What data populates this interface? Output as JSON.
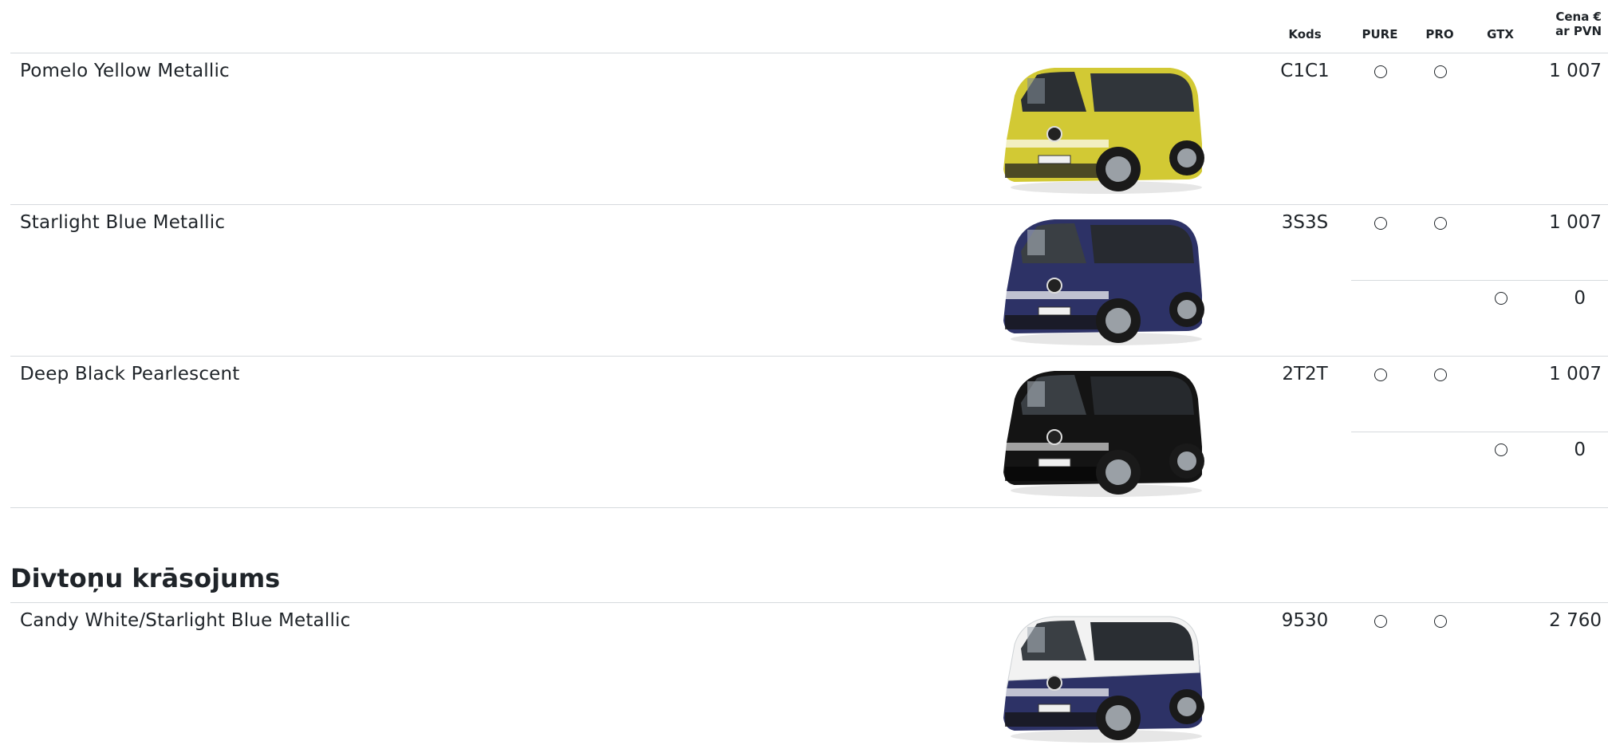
{
  "header": {
    "col_code": "Kods",
    "col_pure": "PURE",
    "col_pro": "PRO",
    "col_gtx": "GTX",
    "col_price_line1": "Cena €",
    "col_price_line2": "ar PVN"
  },
  "colors": {
    "rows": [
      {
        "name": "Pomelo Yellow Metallic",
        "code": "C1C1",
        "price": "1 007",
        "pure": true,
        "pro": true,
        "gtx": false,
        "image": "van-yellow",
        "body_color": "#d2c934"
      },
      {
        "name": "Starlight Blue Metallic",
        "code": "3S3S",
        "price": "1 007",
        "pure": true,
        "pro": true,
        "gtx": false,
        "sub_price": "0",
        "sub_gtx": true,
        "image": "van-blue",
        "body_color": "#2d3266"
      },
      {
        "name": "Deep Black Pearlescent",
        "code": "2T2T",
        "price": "1 007",
        "pure": true,
        "pro": true,
        "gtx": false,
        "sub_price": "0",
        "sub_gtx": true,
        "image": "van-black",
        "body_color": "#141414"
      }
    ]
  },
  "two_tone": {
    "title": "Divtoņu krāsojums",
    "rows": [
      {
        "name": "Candy White/Starlight Blue Metallic",
        "code": "9530",
        "price": "2 760",
        "pure": true,
        "pro": true,
        "gtx": false,
        "image": "van-white-blue",
        "body_color": "#2d3266",
        "top_color": "#f2f2f2"
      }
    ]
  }
}
